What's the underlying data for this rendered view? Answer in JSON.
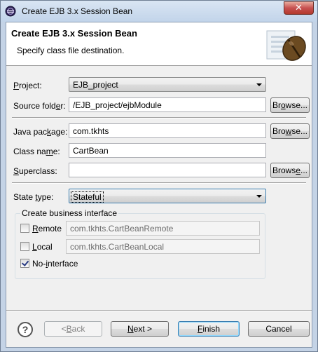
{
  "window": {
    "title": "Create EJB 3.x Session Bean",
    "close_glyph": "✕"
  },
  "banner": {
    "title": "Create EJB 3.x Session Bean",
    "description": "Specify class file destination.",
    "graphic_icon": "coffee-bean-icon"
  },
  "form": {
    "project": {
      "label_pre": "",
      "label_ul": "P",
      "label_post": "roject:",
      "value": "EJB_project"
    },
    "source_folder": {
      "label_pre": "Source fold",
      "label_ul": "e",
      "label_post": "r:",
      "value": "/EJB_project/ejbModule",
      "browse_pre": "Br",
      "browse_ul": "o",
      "browse_post": "wse..."
    },
    "java_package": {
      "label_pre": "Java pac",
      "label_ul": "k",
      "label_post": "age:",
      "value": "com.tkhts",
      "browse_pre": "Bro",
      "browse_ul": "w",
      "browse_post": "se..."
    },
    "class_name": {
      "label_pre": "Class na",
      "label_ul": "m",
      "label_post": "e:",
      "value": "CartBean"
    },
    "superclass": {
      "label_pre": "",
      "label_ul": "S",
      "label_post": "uperclass:",
      "value": "",
      "browse_pre": "Brows",
      "browse_ul": "e",
      "browse_post": "..."
    },
    "state_type": {
      "label_pre": "State ",
      "label_ul": "t",
      "label_post": "ype:",
      "value": "Stateful"
    }
  },
  "business_interface": {
    "group_title": "Create business interface",
    "remote": {
      "label_pre": "",
      "label_ul": "R",
      "label_post": "emote",
      "checked": false,
      "value": "com.tkhts.CartBeanRemote"
    },
    "local": {
      "label_pre": "",
      "label_ul": "L",
      "label_post": "ocal",
      "checked": false,
      "value": "com.tkhts.CartBeanLocal"
    },
    "no_interface": {
      "label_pre": "No-",
      "label_ul": "i",
      "label_post": "nterface",
      "checked": true
    }
  },
  "footer": {
    "help_glyph": "?",
    "back_pre": "< ",
    "back_ul": "B",
    "back_post": "ack",
    "next_pre": "",
    "next_ul": "N",
    "next_post": "ext >",
    "finish_pre": "",
    "finish_ul": "F",
    "finish_post": "inish",
    "cancel": "Cancel"
  }
}
